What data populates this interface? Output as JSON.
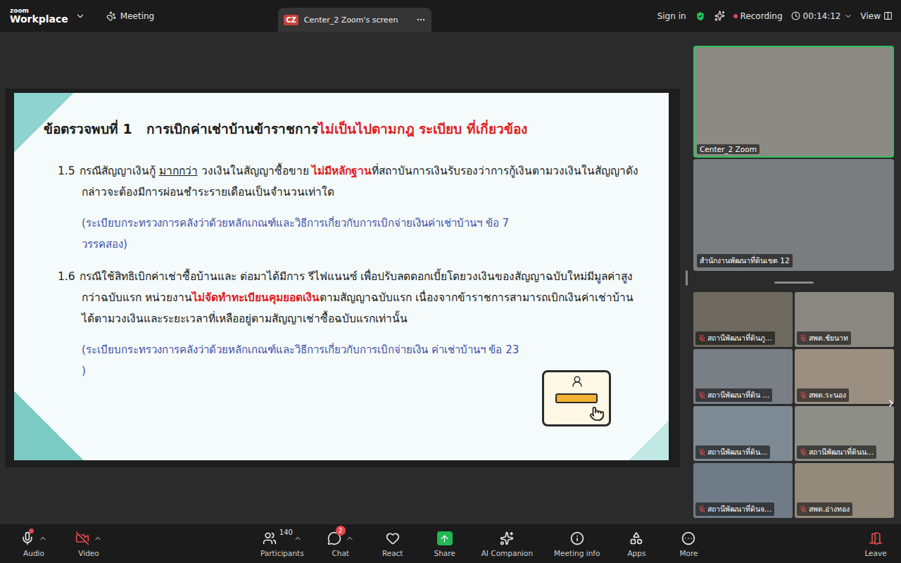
{
  "top_bar": {
    "logo": {
      "brand": "zoom",
      "product": "Workplace"
    },
    "meeting_label": "Meeting",
    "share_tab": {
      "badge": "CZ",
      "title": "Center_2 Zoom's screen"
    },
    "sign_in": "Sign in",
    "recording": {
      "label": "Recording",
      "on": true
    },
    "timer": "00:14:12",
    "view": "View"
  },
  "slide": {
    "title": [
      {
        "text": "ข้อตรวจพบที่ 1   การเบิกค่าเช่าบ้านข้าราชการ",
        "kind": "plain"
      },
      {
        "text": "ไม่เป็นไปตามกฎ ระเบียบ ที่เกี่ยวข้อง",
        "kind": "emphasis"
      }
    ],
    "items": [
      {
        "number": "1.5",
        "segments": [
          {
            "text": "กรณีสัญญาเงินกู้ ",
            "kind": "plain"
          },
          {
            "text": "มากกว่า",
            "kind": "underline"
          },
          {
            "text": " วงเงินในสัญญาซื้อขาย ",
            "kind": "plain"
          },
          {
            "text": "ไม่มีหลักฐาน",
            "kind": "emphasis"
          },
          {
            "text": "ที่สถาบันการเงินรับรองว่าการกู้เงินตามวงเงินในสัญญาดังกล่าวจะต้องมีการผ่อนชำระรายเดือนเป็นจำนวนเท่าใด",
            "kind": "plain"
          }
        ],
        "reference": "(ระเบียบกระทรวงการคลังว่าด้วยหลักเกณฑ์และวิธีการเกี่ยวกับการเบิกจ่ายเงินค่าเช่าบ้านฯ ข้อ 7 วรรคสอง)"
      },
      {
        "number": "1.6",
        "segments": [
          {
            "text": "กรณีใช้สิทธิเบิกค่าเช่าซื้อบ้านและ ต่อมาได้มีการ รีไฟแนนซ์ เพื่อปรับลดดอกเบี้ยโดยวงเงินของสัญญาฉบับใหม่มีมูลค่าสูงกว่าฉบับแรก หน่วยงาน",
            "kind": "plain"
          },
          {
            "text": "ไม่จัดทำทะเบียนคุมยอดเงิน",
            "kind": "emphasis"
          },
          {
            "text": "ตามสัญญาฉบับแรก เนื่องจากข้าราชการสามารถเบิกเงินค่าเช่าบ้านได้ตามวงเงินและระยะเวลาที่เหลืออยู่ตามสัญญาเช่าซื้อฉบับแรกเท่านั้น",
            "kind": "plain"
          }
        ],
        "reference": "(ระเบียบกระทรวงการคลังว่าด้วยหลักเกณฑ์และวิธีการเกี่ยวกับการเบิกจ่ายเงิน ค่าเช่าบ้านฯ ข้อ 23 )"
      }
    ]
  },
  "speaker_tiles": [
    {
      "name": "Center_2 Zoom",
      "active": true
    },
    {
      "name": "สำนักงานพัฒนาที่ดินเขต 12",
      "active": false
    }
  ],
  "gallery": [
    {
      "name": "สถานีพัฒนาที่ดินภู...",
      "muted": true
    },
    {
      "name": "สพด.ชัยนาท",
      "muted": true
    },
    {
      "name": "สถานีพัฒนาที่ดิน ...",
      "muted": true
    },
    {
      "name": "สพด.ระนอง",
      "muted": true
    },
    {
      "name": "สถานีพัฒนาที่ดิน...",
      "muted": true
    },
    {
      "name": "สถานีพัฒนาที่ดินน...",
      "muted": true
    },
    {
      "name": "สถานีพัฒนาที่ดินจ...",
      "muted": true
    },
    {
      "name": "สพด.อ่างทอง",
      "muted": true
    }
  ],
  "toolbar": [
    {
      "label": "Audio",
      "kind": "audio",
      "has_menu": true,
      "alert": true,
      "off": false,
      "count": "",
      "badge": ""
    },
    {
      "label": "Video",
      "kind": "video",
      "has_menu": true,
      "alert": false,
      "off": true,
      "count": "",
      "badge": ""
    },
    {
      "label": "Participants",
      "kind": "participants",
      "has_menu": true,
      "alert": false,
      "off": false,
      "count": "140",
      "badge": ""
    },
    {
      "label": "Chat",
      "kind": "chat",
      "has_menu": true,
      "alert": false,
      "off": false,
      "count": "",
      "badge": "2"
    },
    {
      "label": "React",
      "kind": "react",
      "has_menu": false,
      "alert": false,
      "off": false,
      "count": "",
      "badge": ""
    },
    {
      "label": "Share",
      "kind": "share",
      "has_menu": false,
      "alert": false,
      "off": false,
      "count": "",
      "badge": ""
    },
    {
      "label": "AI Companion",
      "kind": "ai",
      "has_menu": false,
      "alert": false,
      "off": false,
      "count": "",
      "badge": ""
    },
    {
      "label": "Meeting info",
      "kind": "info",
      "has_menu": false,
      "alert": false,
      "off": false,
      "count": "",
      "badge": ""
    },
    {
      "label": "Apps",
      "kind": "apps",
      "has_menu": false,
      "alert": false,
      "off": false,
      "count": "",
      "badge": ""
    },
    {
      "label": "More",
      "kind": "more",
      "has_menu": false,
      "alert": false,
      "off": false,
      "count": "",
      "badge": ""
    },
    {
      "label": "Leave",
      "kind": "leave",
      "has_menu": false,
      "alert": false,
      "off": false,
      "count": "",
      "badge": ""
    }
  ]
}
